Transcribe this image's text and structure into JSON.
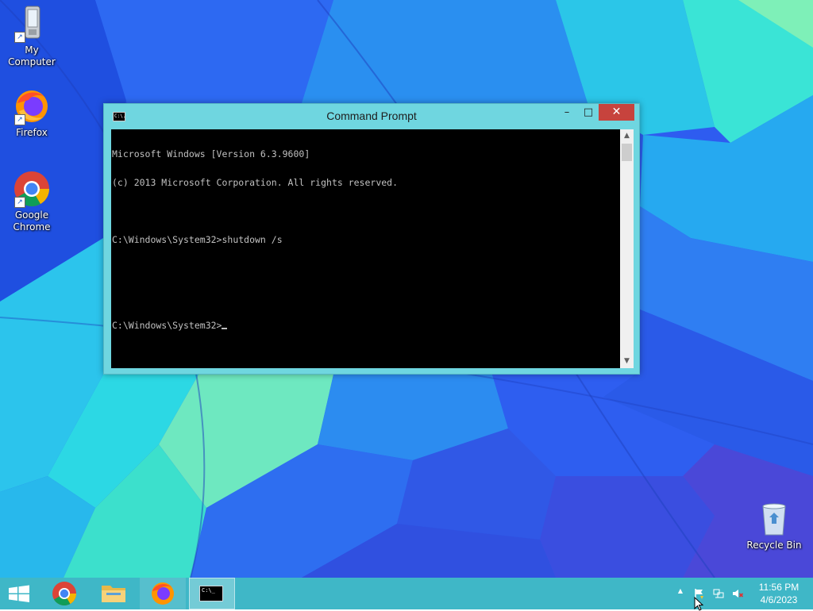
{
  "desktop": {
    "icons": [
      {
        "label": "My Computer",
        "icon": "my-computer-icon"
      },
      {
        "label": "Firefox",
        "icon": "firefox-icon"
      },
      {
        "label": "Google Chrome",
        "icon": "chrome-icon"
      },
      {
        "label": "Recycle Bin",
        "icon": "recycle-bin-icon"
      }
    ]
  },
  "window": {
    "title": "Command Prompt",
    "icon_text": "C:\\.",
    "minimize_symbol": "–",
    "maximize_symbol": "□",
    "close_symbol": "✕",
    "console_lines": [
      "Microsoft Windows [Version 6.3.9600]",
      "(c) 2013 Microsoft Corporation. All rights reserved.",
      "",
      "C:\\Windows\\System32>shutdown /s",
      "",
      "",
      "C:\\Windows\\System32>"
    ],
    "scroll_up_symbol": "▲",
    "scroll_down_symbol": "▼"
  },
  "taskbar": {
    "apps": [
      {
        "name": "Start",
        "icon": "windows-logo-icon"
      },
      {
        "name": "Google Chrome",
        "icon": "chrome-icon"
      },
      {
        "name": "File Explorer",
        "icon": "folder-icon"
      },
      {
        "name": "Firefox",
        "icon": "firefox-icon"
      },
      {
        "name": "Command Prompt",
        "icon": "cmd-icon",
        "active": true
      }
    ],
    "cmd_icon_text": "C:\\_",
    "tray": {
      "show_hidden_symbol": "▲",
      "time": "11:56 PM",
      "date": "4/6/2023"
    }
  },
  "colors": {
    "taskbar": "#3fb7c7",
    "window_frame": "#6fd6e0",
    "close_button": "#c7433d",
    "console_bg": "#000000",
    "console_text": "#c0c0c0"
  }
}
